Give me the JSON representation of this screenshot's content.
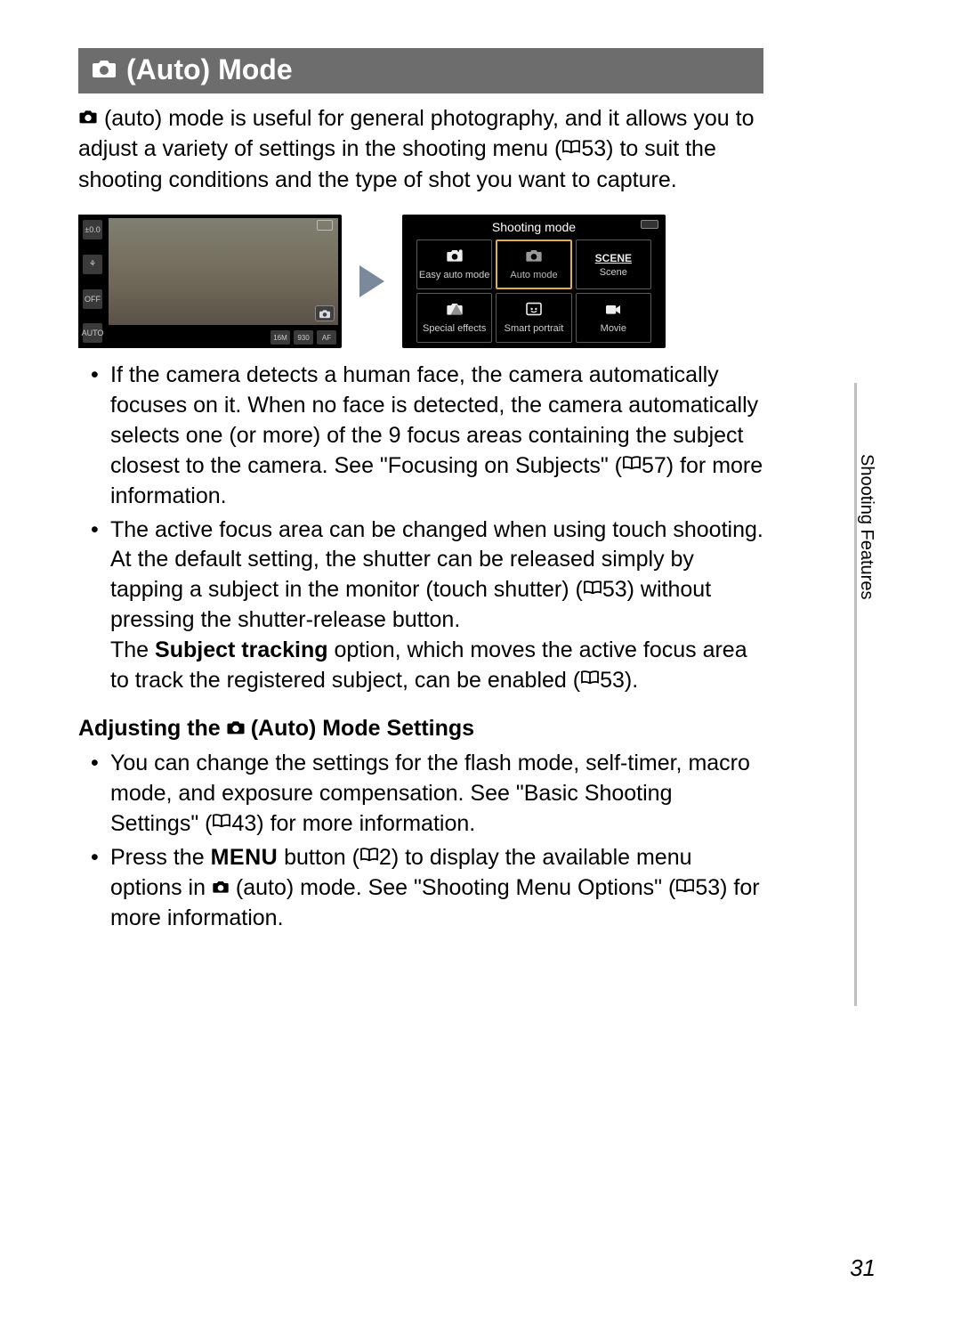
{
  "title": "(Auto) Mode",
  "intro_a": "(auto) mode is useful for general photography, and it allows you to adjust a variety of settings in the shooting menu (",
  "intro_ref": "53",
  "intro_b": ") to suit the shooting conditions and the type of shot you want to capture.",
  "shooting_mode_header": "Shooting mode",
  "modes": [
    {
      "label": "Easy auto mode",
      "name": "easy-auto"
    },
    {
      "label": "Auto mode",
      "name": "auto",
      "selected": true
    },
    {
      "label": "Scene",
      "name": "scene"
    },
    {
      "label": "Special effects",
      "name": "special-effects"
    },
    {
      "label": "Smart portrait",
      "name": "smart-portrait"
    },
    {
      "label": "Movie",
      "name": "movie"
    }
  ],
  "bullet1_a": "If the camera detects a human face, the camera automatically focuses on it. When no face is detected, the camera automatically selects one (or more) of the 9 focus areas containing the subject closest to the camera. See \"Focusing on Subjects\" (",
  "bullet1_ref": "57",
  "bullet1_b": ") for more information.",
  "bullet2_a": "The active focus area can be changed when using touch shooting. At the default setting, the shutter can be released simply by tapping a subject in the monitor (touch shutter) (",
  "bullet2_ref1": "53",
  "bullet2_b": ") without pressing the shutter-release button.",
  "bullet2_c": "The ",
  "bullet2_bold": "Subject tracking",
  "bullet2_d": " option, which moves the active focus area to track the registered subject, can be enabled (",
  "bullet2_ref2": "53",
  "bullet2_e": ").",
  "subhead_a": "Adjusting the ",
  "subhead_b": " (Auto) Mode Settings",
  "sb1_a": "You can change the settings for the flash mode, self-timer, macro mode, and exposure compensation. See \"Basic Shooting Settings\" (",
  "sb1_ref": "43",
  "sb1_b": ") for more information.",
  "sb2_a": "Press the ",
  "sb2_menu": "MENU",
  "sb2_b": " button (",
  "sb2_ref1": "2",
  "sb2_c": ") to display the available menu options in ",
  "sb2_d": " (auto) mode. See \"Shooting Menu Options\" (",
  "sb2_ref2": "53",
  "sb2_e": ") for more information.",
  "side_tab": "Shooting Features",
  "page_number": "31",
  "left_strip": {
    "a": "±0.0",
    "b": "⚘",
    "c": "OFF",
    "d": "AUTO"
  },
  "scene_label": "SCENE",
  "badge_16": "16M",
  "badge_930": "930"
}
